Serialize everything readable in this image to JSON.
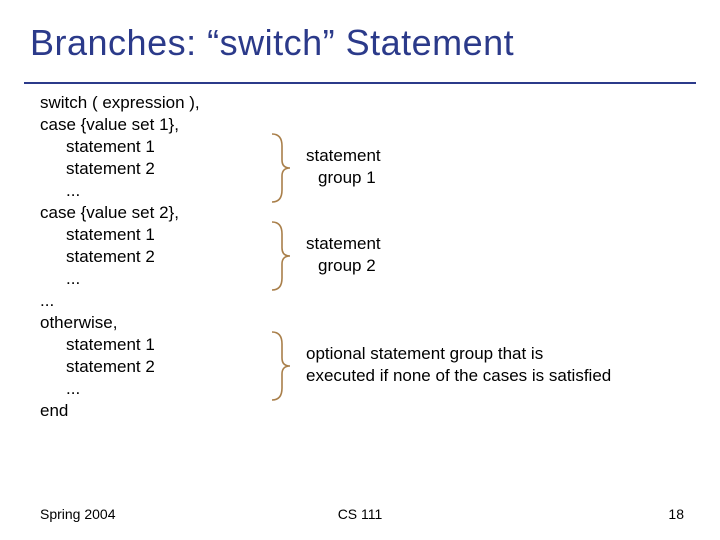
{
  "title": "Branches: “switch” Statement",
  "code": {
    "l1": "switch ( expression ),",
    "l2": "case {value set 1},",
    "l3": "statement 1",
    "l4": "statement 2",
    "l5": "...",
    "l6": "case {value set 2},",
    "l7": "statement 1",
    "l8": "statement 2",
    "l9": "...",
    "l10": "...",
    "l11": "otherwise,",
    "l12": "statement 1",
    "l13": "statement 2",
    "l14": "...",
    "l15": "end"
  },
  "annot": {
    "g1a": "statement",
    "g1b": "group 1",
    "g2a": "statement",
    "g2b": "group 2",
    "g3a": "optional statement group that is",
    "g3b": "executed if none of the cases is satisfied"
  },
  "footer": {
    "left": "Spring 2004",
    "center": "CS 111",
    "right": "18"
  }
}
